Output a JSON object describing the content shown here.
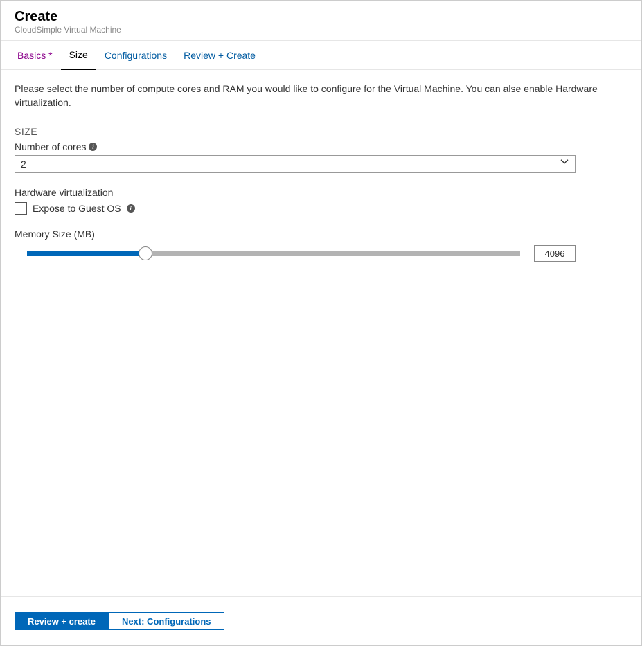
{
  "header": {
    "title": "Create",
    "subtitle": "CloudSimple Virtual Machine"
  },
  "tabs": [
    {
      "label": "Basics *",
      "state": "visited"
    },
    {
      "label": "Size",
      "state": "active"
    },
    {
      "label": "Configurations",
      "state": "default"
    },
    {
      "label": "Review + Create",
      "state": "default"
    }
  ],
  "description": "Please select the number of compute cores and RAM you would like to configure for the Virtual Machine. You can alse enable Hardware virtualization.",
  "section": {
    "size_h": "SIZE"
  },
  "cores": {
    "label": "Number of cores",
    "value": "2"
  },
  "hw": {
    "label": "Hardware virtualization",
    "checkbox_label": "Expose to Guest OS",
    "checked": false
  },
  "memory": {
    "label": "Memory Size (MB)",
    "value": "4096",
    "percent": 24
  },
  "footer": {
    "primary": "Review + create",
    "secondary": "Next: Configurations"
  }
}
